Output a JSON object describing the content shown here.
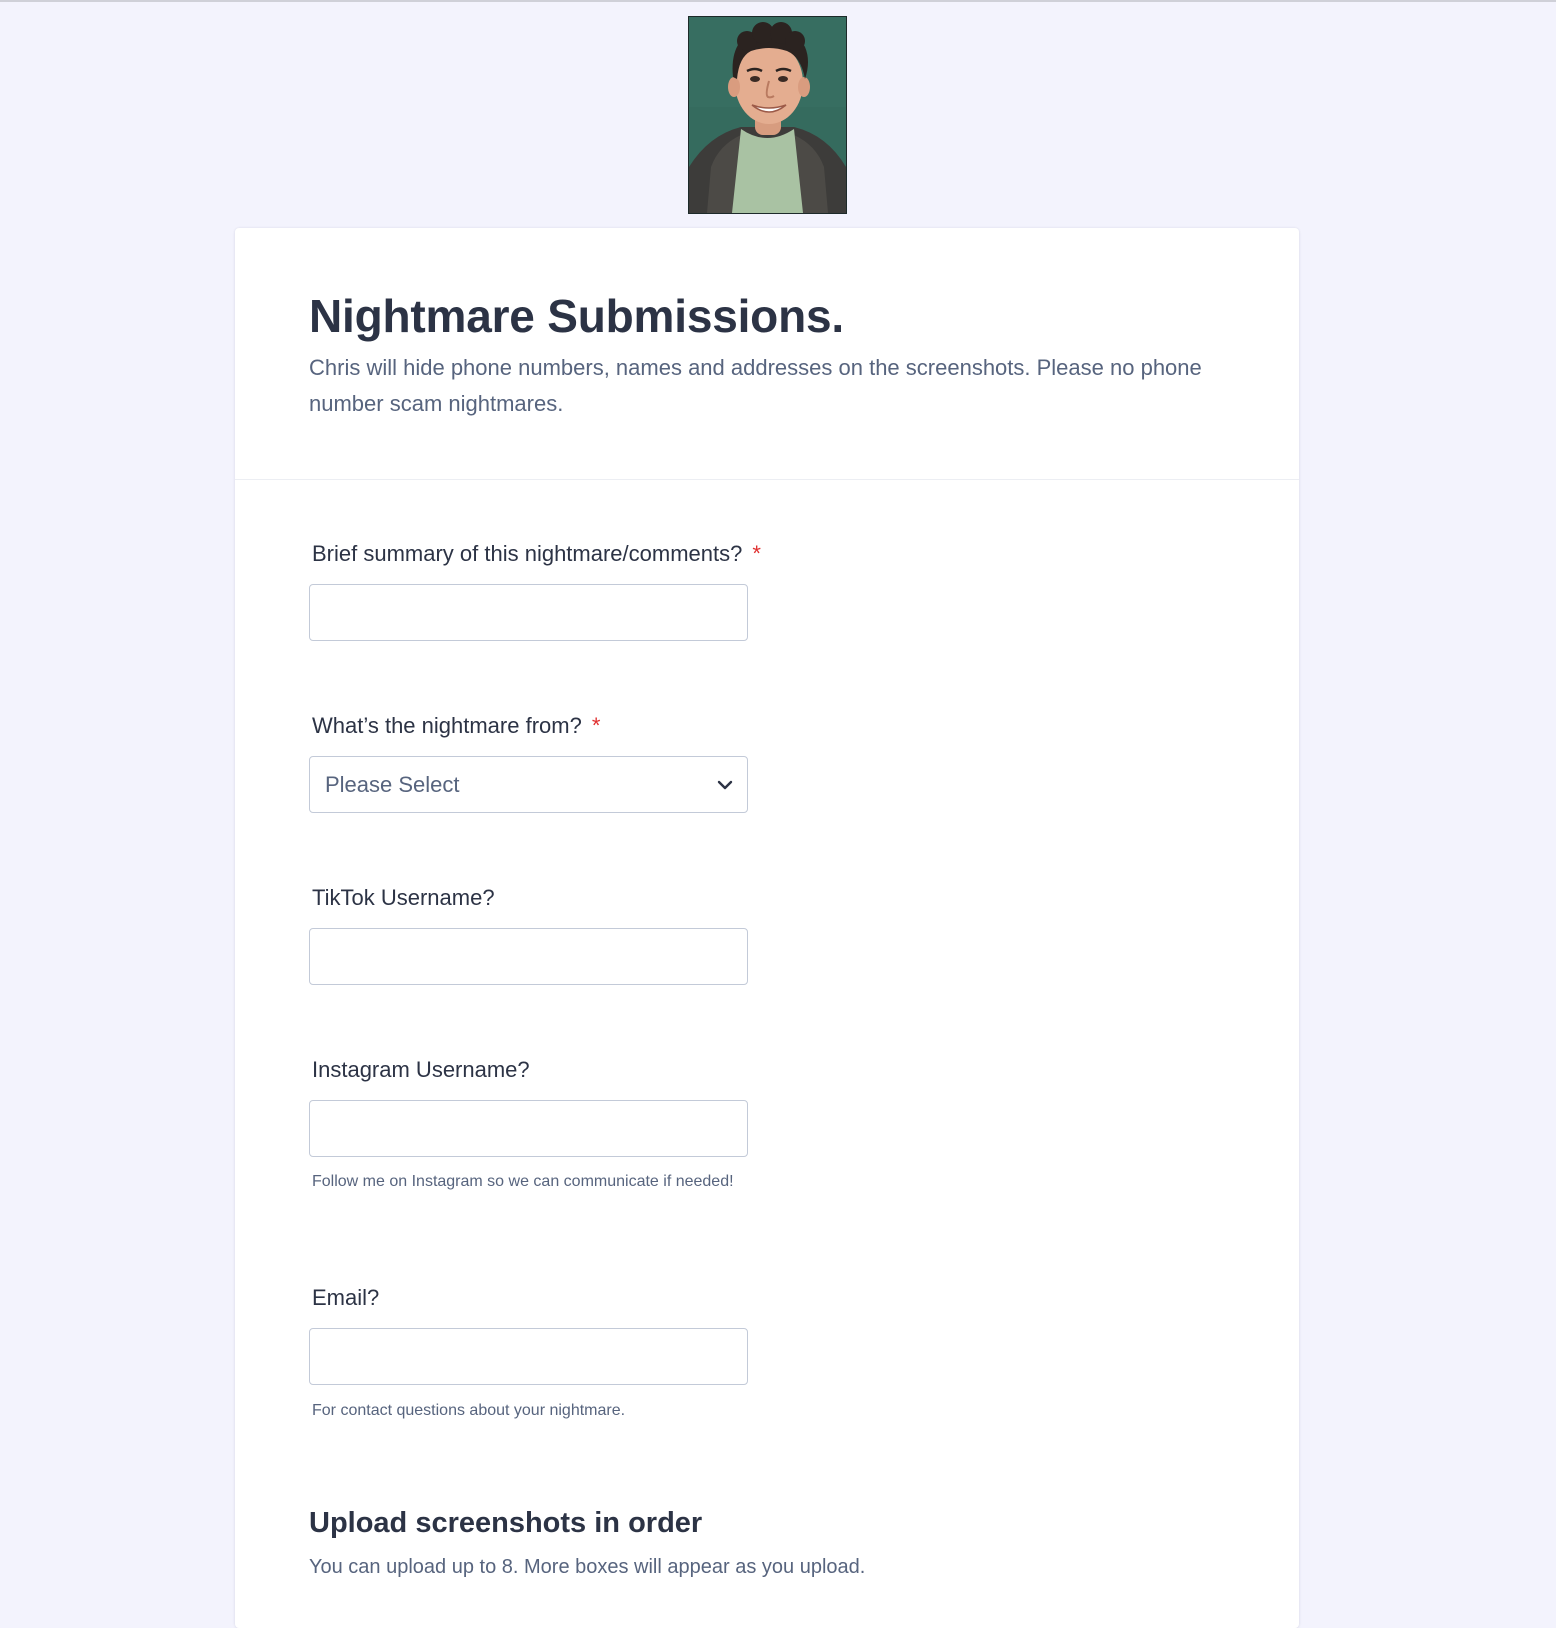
{
  "header": {
    "photo_alt": "Chris"
  },
  "form": {
    "title": "Nightmare Submissions.",
    "subtitle": "Chris will hide phone numbers, names and addresses on the screenshots. Please no phone number scam nightmares.",
    "fields": {
      "summary": {
        "label": "Brief summary of this nightmare/comments?",
        "required_mark": "*",
        "value": ""
      },
      "source": {
        "label": "What’s the nightmare from?",
        "required_mark": "*",
        "selected": "Please Select"
      },
      "tiktok": {
        "label": "TikTok Username?",
        "value": ""
      },
      "instagram": {
        "label": "Instagram Username?",
        "value": "",
        "sublabel": "Follow me on Instagram so we can communicate if needed!"
      },
      "email": {
        "label": "Email?",
        "value": "",
        "sublabel": "For contact questions about your nightmare."
      }
    },
    "upload_section": {
      "title": "Upload screenshots in order",
      "description": "You can upload up to 8. More boxes will appear as you upload."
    }
  },
  "colors": {
    "page_background": "#f3f3fd",
    "text_primary": "#2c3345",
    "text_secondary": "#57647e",
    "required": "#e02f2f",
    "input_border": "#c3cad8"
  }
}
